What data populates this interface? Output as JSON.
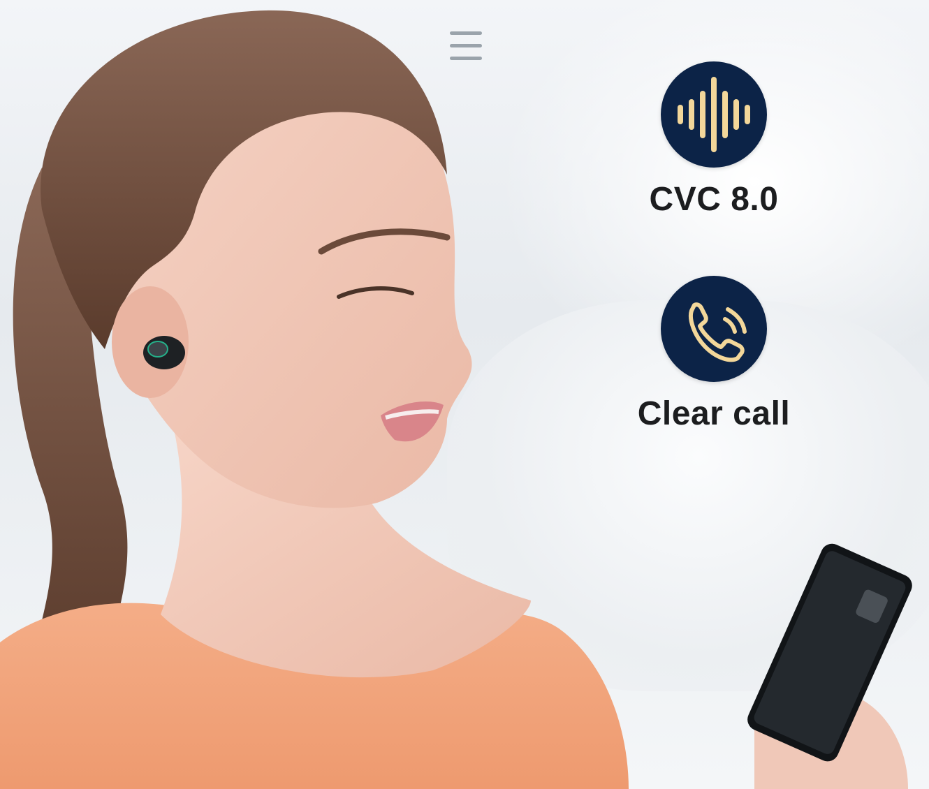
{
  "features": [
    {
      "icon": "sound-wave-icon",
      "label": "CVC 8.0"
    },
    {
      "icon": "phone-call-icon",
      "label": "Clear call"
    }
  ],
  "menu_icon": "hamburger-menu-icon",
  "colors": {
    "icon_circle": "#0c2347",
    "icon_stroke": "#f3d79a",
    "label_text": "#1c1d1f",
    "menu": "#9aa3ab",
    "shirt": "#f2a27a",
    "hair": "#6b4a3a"
  }
}
